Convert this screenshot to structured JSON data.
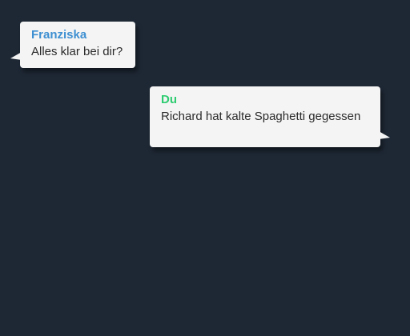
{
  "messages": [
    {
      "sender": "Franziska",
      "text": "Alles klar bei dir?",
      "direction": "incoming",
      "sender_color": "#3d8fd1"
    },
    {
      "sender": "Du",
      "text": "Richard hat kalte Spaghetti gegessen",
      "direction": "outgoing",
      "sender_color": "#2ecc71"
    }
  ],
  "colors": {
    "background": "#1e2835",
    "bubble": "#f4f4f4"
  }
}
